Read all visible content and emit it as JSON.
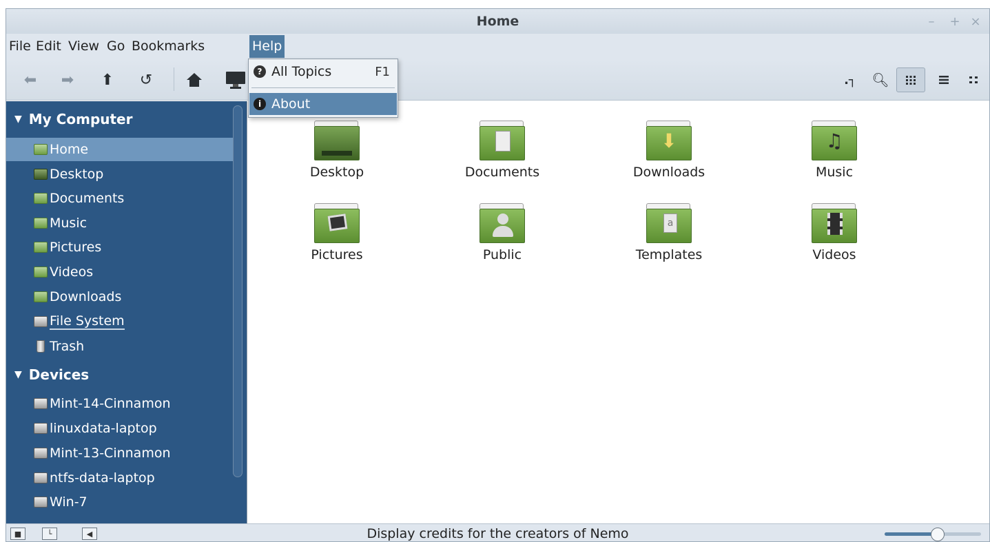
{
  "window": {
    "title": "Home"
  },
  "titlebar_buttons": {
    "minimize": "–",
    "maximize": "+",
    "close": "×"
  },
  "menubar": {
    "items": [
      {
        "label": "File"
      },
      {
        "label": "Edit"
      },
      {
        "label": "View"
      },
      {
        "label": "Go"
      },
      {
        "label": "Bookmarks"
      },
      {
        "label": "Help",
        "active": true
      }
    ]
  },
  "help_menu": {
    "items": [
      {
        "label": "All Topics",
        "accel": "F1",
        "icon": "help-icon"
      },
      {
        "label": "About",
        "icon": "info-icon",
        "highlighted": true
      }
    ]
  },
  "toolbar": {
    "icons": [
      "back-icon",
      "forward-icon",
      "up-icon",
      "reload-icon",
      "home-icon",
      "computer-icon",
      "toggle-location-icon",
      "search-icon",
      "icon-view-icon",
      "list-view-icon",
      "compact-view-icon"
    ]
  },
  "sidebar": {
    "sections": [
      {
        "title": "My Computer",
        "items": [
          {
            "label": "Home",
            "icon": "home-folder-icon",
            "selected": true
          },
          {
            "label": "Desktop",
            "icon": "desktop-icon"
          },
          {
            "label": "Documents",
            "icon": "folder-icon"
          },
          {
            "label": "Music",
            "icon": "folder-icon"
          },
          {
            "label": "Pictures",
            "icon": "folder-icon"
          },
          {
            "label": "Videos",
            "icon": "folder-icon"
          },
          {
            "label": "Downloads",
            "icon": "folder-icon"
          },
          {
            "label": "File System",
            "icon": "drive-icon"
          },
          {
            "label": "Trash",
            "icon": "trash-icon"
          }
        ]
      },
      {
        "title": "Devices",
        "items": [
          {
            "label": "Mint-14-Cinnamon",
            "icon": "drive-icon"
          },
          {
            "label": "linuxdata-laptop",
            "icon": "drive-icon"
          },
          {
            "label": "Mint-13-Cinnamon",
            "icon": "drive-icon"
          },
          {
            "label": "ntfs-data-laptop",
            "icon": "drive-icon"
          },
          {
            "label": "Win-7",
            "icon": "drive-icon"
          }
        ]
      }
    ]
  },
  "files": [
    {
      "label": "Desktop",
      "icon": "desktop-folder-icon"
    },
    {
      "label": "Documents",
      "icon": "documents-folder-icon"
    },
    {
      "label": "Downloads",
      "icon": "downloads-folder-icon"
    },
    {
      "label": "Music",
      "icon": "music-folder-icon"
    },
    {
      "label": "Pictures",
      "icon": "pictures-folder-icon"
    },
    {
      "label": "Public",
      "icon": "public-folder-icon"
    },
    {
      "label": "Templates",
      "icon": "templates-folder-icon"
    },
    {
      "label": "Videos",
      "icon": "videos-folder-icon"
    }
  ],
  "statusbar": {
    "text": "Display credits for the creators of Nemo",
    "zoom_level": 0.55
  },
  "colors": {
    "sidebar_bg": "#2c5784",
    "selection": "#6f97be",
    "menu_active": "#4f7ba1",
    "folder_green": "#6e9e44"
  }
}
